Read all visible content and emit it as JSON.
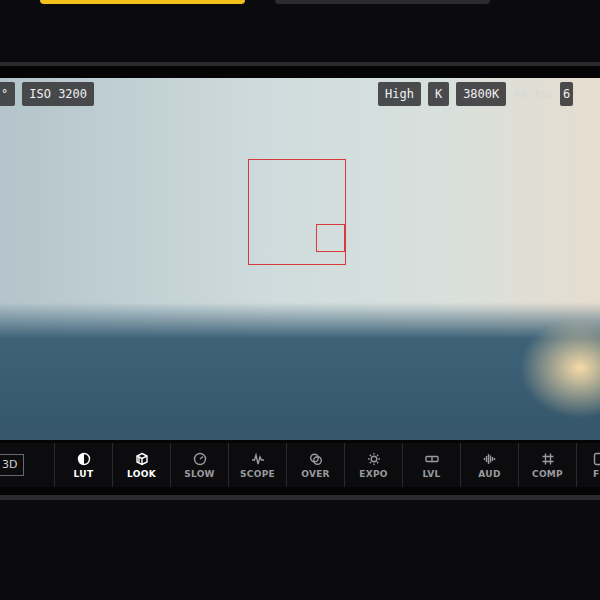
{
  "overlay": {
    "left_badges": [
      "°",
      "ISO 3200"
    ],
    "right_badges": [
      "High",
      "K",
      "3800K"
    ],
    "fps": "49 fps",
    "battery": "6"
  },
  "toolbar": {
    "items": [
      {
        "label": "3D",
        "selected": false,
        "kind": "toggle"
      },
      {
        "label": "LUT",
        "selected": true,
        "kind": "tool"
      },
      {
        "label": "LOOK",
        "selected": true,
        "kind": "tool"
      },
      {
        "label": "SLOW",
        "selected": false,
        "kind": "tool"
      },
      {
        "label": "SCOPE",
        "selected": false,
        "kind": "tool"
      },
      {
        "label": "OVER",
        "selected": false,
        "kind": "tool"
      },
      {
        "label": "EXPO",
        "selected": false,
        "kind": "tool"
      },
      {
        "label": "LVL",
        "selected": false,
        "kind": "tool"
      },
      {
        "label": "AUD",
        "selected": false,
        "kind": "tool"
      },
      {
        "label": "COMP",
        "selected": false,
        "kind": "tool"
      },
      {
        "label": "F",
        "selected": false,
        "kind": "tool"
      }
    ]
  }
}
